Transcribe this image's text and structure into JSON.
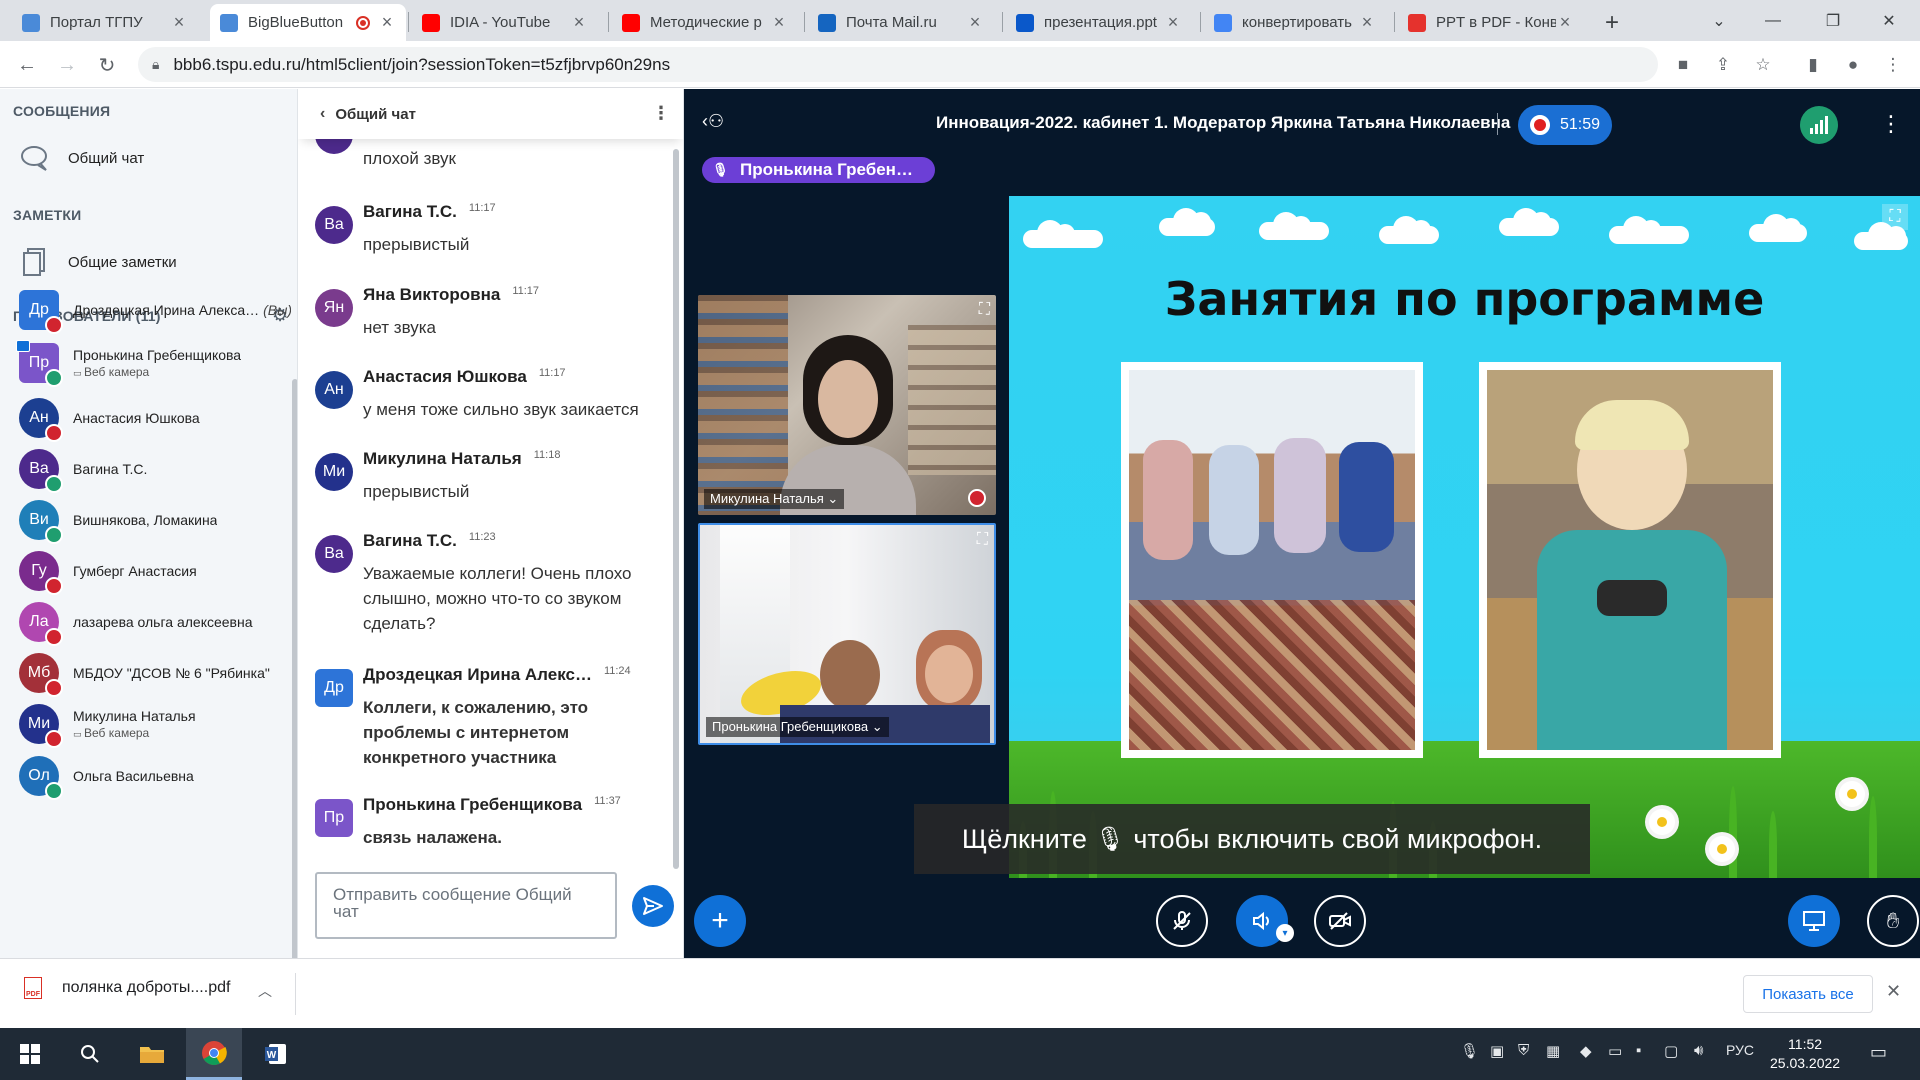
{
  "browser": {
    "tabs": [
      {
        "title": "Портал ТГПУ",
        "favicon": "tspu-icon",
        "color": "#4a8ad8"
      },
      {
        "title": "BigBlueButton",
        "favicon": "bbb-icon",
        "color": "#4a8ad8",
        "recording": true
      },
      {
        "title": "IDIA - YouTube",
        "favicon": "youtube-icon",
        "color": "#ff0000"
      },
      {
        "title": "Методические р",
        "favicon": "youtube-icon",
        "color": "#ff0000"
      },
      {
        "title": "Почта Mail.ru",
        "favicon": "mail-icon",
        "color": "#1565c0"
      },
      {
        "title": "презентация.ppt",
        "favicon": "onedrive-icon",
        "color": "#0a58ca"
      },
      {
        "title": "конвертировать",
        "favicon": "google-icon",
        "color": "#4285f4"
      },
      {
        "title": "PPT в PDF - Конв",
        "favicon": "ilovepdf-icon",
        "color": "#e5322d"
      }
    ],
    "new_tab": "+",
    "url": "bbb6.tspu.edu.ru/html5client/join?sessionToken=t5zfjbrvp60n29ns"
  },
  "left_panel": {
    "messages_header": "СООБЩЕНИЯ",
    "public_chat": "Общий чат",
    "notes_header": "ЗАМЕТКИ",
    "shared_notes": "Общие заметки",
    "users_header": "ПОЛЬЗОВАТЕЛИ (11)",
    "users": [
      {
        "initials": "Др",
        "name": "Дроздецкая Ирина Алекса…",
        "you": "(Вы)",
        "color": "#2d74d8",
        "shape": "sq",
        "mic": "#d1242f",
        "sub": "",
        "cam": false
      },
      {
        "initials": "Пр",
        "name": "Пронькина Гребенщикова",
        "you": "",
        "color": "#7b55c9",
        "shape": "sq",
        "mic": "#1f9e6f",
        "sub": "Веб камера",
        "cam": true
      },
      {
        "initials": "Ан",
        "name": "Анастасия Юшкова",
        "you": "",
        "color": "#1c3f91",
        "shape": "round",
        "mic": "#d1242f",
        "sub": "",
        "cam": false
      },
      {
        "initials": "Ва",
        "name": "Вагина Т.С.",
        "you": "",
        "color": "#4d2a8c",
        "shape": "round",
        "mic": "#1f9e6f",
        "sub": "",
        "cam": false
      },
      {
        "initials": "Ви",
        "name": "Вишнякова, Ломакина",
        "you": "",
        "color": "#1f7fb8",
        "shape": "round",
        "mic": "#1f9e6f",
        "sub": "",
        "cam": false
      },
      {
        "initials": "Гу",
        "name": "Гумберг Анастасия",
        "you": "",
        "color": "#7a2b8d",
        "shape": "round",
        "mic": "#d1242f",
        "sub": "",
        "cam": false
      },
      {
        "initials": "Ла",
        "name": "лазарева ольга алексеевна",
        "you": "",
        "color": "#b047b0",
        "shape": "round",
        "mic": "#d1242f",
        "sub": "",
        "cam": false
      },
      {
        "initials": "Мб",
        "name": "МБДОУ \"ДСОВ № 6 \"Рябинка\"",
        "you": "",
        "color": "#a33039",
        "shape": "round",
        "mic": "#d1242f",
        "sub": "",
        "cam": false
      },
      {
        "initials": "Ми",
        "name": "Микулина Наталья",
        "you": "",
        "color": "#23318c",
        "shape": "round",
        "mic": "#d1242f",
        "sub": "Веб камера",
        "cam": false
      },
      {
        "initials": "Ол",
        "name": "Ольга Васильевна",
        "you": "",
        "color": "#1f6fb8",
        "shape": "round",
        "mic": "#1f9e6f",
        "sub": "",
        "cam": false
      }
    ]
  },
  "chat": {
    "title": "Общий чат",
    "partial_message": "плохой звук",
    "messages": [
      {
        "initials": "Ва",
        "name": "Вагина Т.С.",
        "time": "11:17",
        "text": "прерывистый",
        "color": "#4d2a8c",
        "shape": "round",
        "bold": false
      },
      {
        "initials": "Ян",
        "name": "Яна Викторовна",
        "time": "11:17",
        "text": "нет звука",
        "color": "#7a3b8d",
        "shape": "round",
        "bold": false
      },
      {
        "initials": "Ан",
        "name": "Анастасия Юшкова",
        "time": "11:17",
        "text": "у меня тоже сильно звук заикается",
        "color": "#1c3f91",
        "shape": "round",
        "bold": false
      },
      {
        "initials": "Ми",
        "name": "Микулина Наталья",
        "time": "11:18",
        "text": "прерывистый",
        "color": "#23318c",
        "shape": "round",
        "bold": false
      },
      {
        "initials": "Ва",
        "name": "Вагина Т.С.",
        "time": "11:23",
        "text": "Уважаемые коллеги! Очень плохо слышно, можно что-то со звуком сделать?",
        "color": "#4d2a8c",
        "shape": "round",
        "bold": false
      },
      {
        "initials": "Др",
        "name": "Дроздецкая Ирина Алекс…",
        "time": "11:24",
        "text": "Коллеги, к сожалению, это проблемы с интернетом конкретного участника",
        "color": "#2d74d8",
        "shape": "sq",
        "bold": true
      },
      {
        "initials": "Пр",
        "name": "Пронькина Гребенщикова",
        "time": "11:37",
        "text": "связь налажена.",
        "color": "#7b55c9",
        "shape": "sq",
        "bold": true
      }
    ],
    "input_placeholder": "Отправить сообщение Общий чат"
  },
  "meeting": {
    "title": "Инновация-2022. кабинет 1. Модератор Яркина Татьяна Николаевна",
    "timer": "51:59",
    "talking": "Пронькина Гребен…",
    "videos": [
      {
        "label": "Микулина Наталья",
        "muted": true
      },
      {
        "label": "Пронькина Гребенщикова",
        "muted": false
      }
    ],
    "slide_title": "Занятия по программе",
    "tip_before": "Щёлкните",
    "tip_after": "чтобы включить свой микрофон."
  },
  "downloads": {
    "file": "полянка доброты....pdf",
    "show_all": "Показать все"
  },
  "taskbar": {
    "lang": "РУС",
    "time": "11:52",
    "date": "25.03.2022"
  }
}
